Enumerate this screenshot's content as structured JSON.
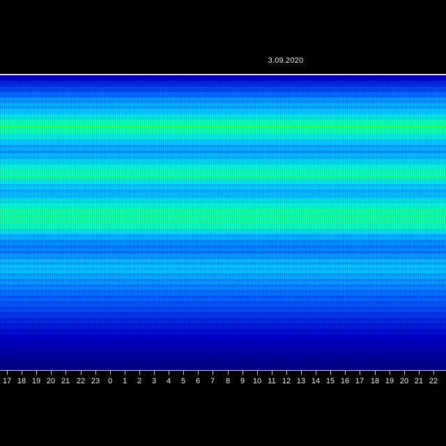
{
  "chart_data": {
    "type": "heatmap",
    "title": "3.09.2020",
    "xlabel": "",
    "ylabel": "",
    "x_ticks": [
      "17",
      "18",
      "19",
      "20",
      "21",
      "22",
      "23",
      "0",
      "1",
      "2",
      "3",
      "4",
      "5",
      "6",
      "7",
      "8",
      "9",
      "10",
      "11",
      "12",
      "13",
      "14",
      "15",
      "16",
      "17",
      "18",
      "19",
      "20",
      "21",
      "22"
    ],
    "grid": false,
    "colormap": [
      "#000060",
      "#0000c8",
      "#0060ff",
      "#00c8ff",
      "#00ffc8",
      "#40ff40"
    ],
    "row_intensity": [
      0.18,
      0.32,
      0.42,
      0.55,
      0.6,
      0.78,
      0.95,
      0.8,
      0.6,
      0.55,
      0.65,
      0.85,
      0.88,
      0.65,
      0.58,
      0.75,
      0.88,
      0.9,
      0.85,
      0.6,
      0.5,
      0.48,
      0.58,
      0.62,
      0.55,
      0.5,
      0.44,
      0.4,
      0.36,
      0.3,
      0.26,
      0.22,
      0.18,
      0.14,
      0.1,
      0.06
    ]
  }
}
